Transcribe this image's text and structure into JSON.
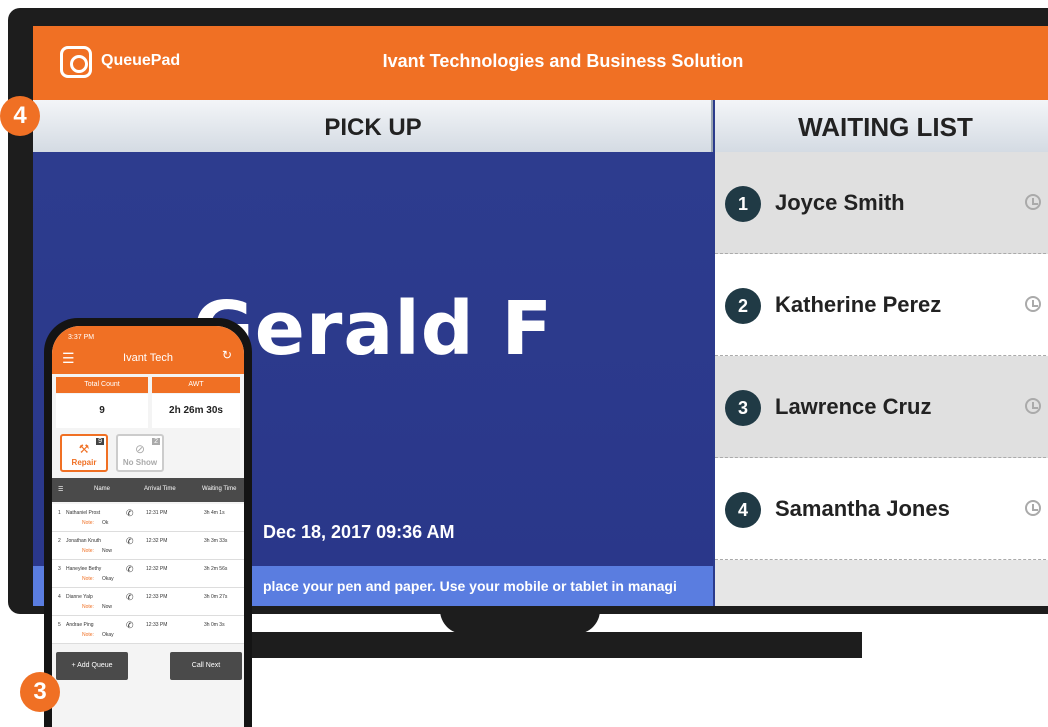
{
  "tv": {
    "brand": "QueuePad",
    "company": "Ivant Technologies and Business Solution",
    "pickup_title": "PICK UP",
    "pickup_name": "Gerald F",
    "pickup_date": "Dec 18, 2017 09:36 AM",
    "ticker": "place your pen and paper. Use your mobile or tablet in managi",
    "waiting_title": "WAITING LIST",
    "waiting": [
      {
        "num": "1",
        "name": "Joyce Smith"
      },
      {
        "num": "2",
        "name": "Katherine Perez"
      },
      {
        "num": "3",
        "name": "Lawrence Cruz"
      },
      {
        "num": "4",
        "name": "Samantha Jones"
      }
    ]
  },
  "badges": {
    "tv": "4",
    "phone": "3"
  },
  "phone": {
    "time": "3:37 PM",
    "title": "Ivant Tech",
    "total_count_label": "Total Count",
    "total_count": "9",
    "awt_label": "AWT",
    "awt": "2h 26m 30s",
    "services": [
      {
        "label": "Repair",
        "count": "9"
      },
      {
        "label": "No Show",
        "count": "2"
      }
    ],
    "columns": [
      "Name",
      "Arrival Time",
      "Waiting Time"
    ],
    "rows": [
      {
        "num": "1",
        "name": "Nathaniel Prost",
        "note": "Ok",
        "time": "12:31 PM",
        "wait": "3h 4m 1s"
      },
      {
        "num": "2",
        "name": "Jonathan Knuth",
        "note": "Now",
        "time": "12:32 PM",
        "wait": "3h 3m 33s"
      },
      {
        "num": "3",
        "name": "Haneylee Bethy",
        "note": "Okay",
        "time": "12:32 PM",
        "wait": "3h 2m 56s"
      },
      {
        "num": "4",
        "name": "Dianne Yalp",
        "note": "Now",
        "time": "12:33 PM",
        "wait": "3h 0m 27s"
      },
      {
        "num": "5",
        "name": "Andrae Ping",
        "note": "Okay",
        "time": "12:33 PM",
        "wait": "3h 0m 3s"
      }
    ],
    "note_label": "Note:",
    "add_button": "+ Add Queue",
    "call_button": "Call Next"
  }
}
